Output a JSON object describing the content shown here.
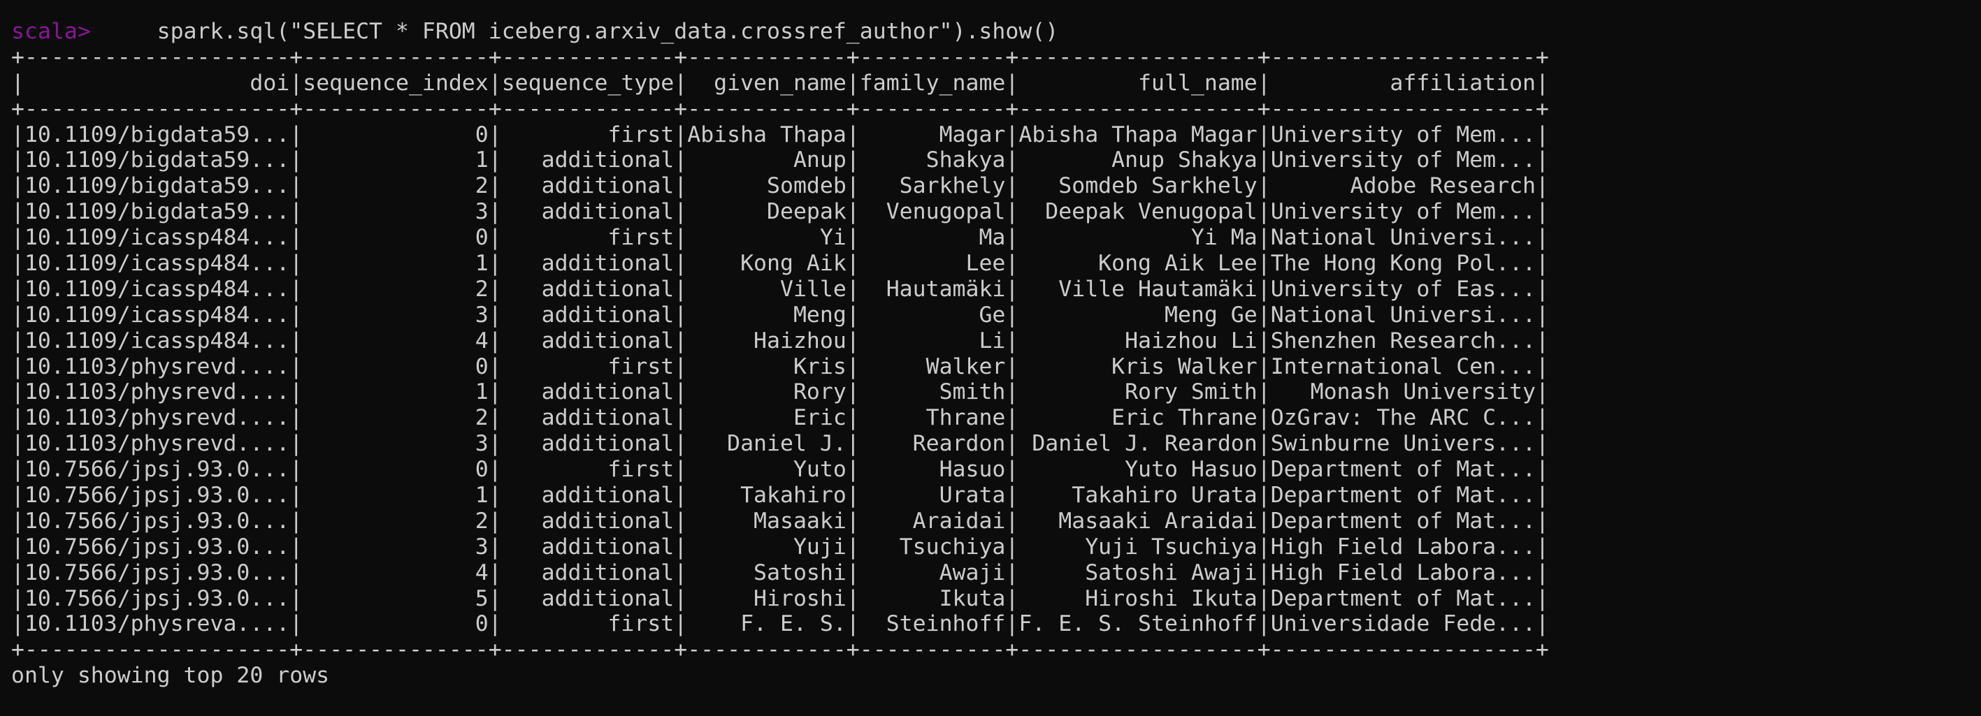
{
  "terminal": {
    "prompt": "scala>",
    "command": "spark.sql(\"SELECT * FROM iceberg.arxiv_data.crossref_author\").show()",
    "footer": "only showing top 20 rows",
    "colors": {
      "background": "#0c0c0c",
      "text": "#cccccc",
      "prompt": "#881798"
    }
  },
  "table": {
    "columns": [
      "doi",
      "sequence_index",
      "sequence_type",
      "given_name",
      "family_name",
      "full_name",
      "affiliation"
    ],
    "rows": [
      [
        "10.1109/bigdata59...",
        "0",
        "first",
        "Abisha Thapa",
        "Magar",
        "Abisha Thapa Magar",
        "University of Mem..."
      ],
      [
        "10.1109/bigdata59...",
        "1",
        "additional",
        "Anup",
        "Shakya",
        "Anup Shakya",
        "University of Mem..."
      ],
      [
        "10.1109/bigdata59...",
        "2",
        "additional",
        "Somdeb",
        "Sarkhely",
        "Somdeb Sarkhely",
        "Adobe Research"
      ],
      [
        "10.1109/bigdata59...",
        "3",
        "additional",
        "Deepak",
        "Venugopal",
        "Deepak Venugopal",
        "University of Mem..."
      ],
      [
        "10.1109/icassp484...",
        "0",
        "first",
        "Yi",
        "Ma",
        "Yi Ma",
        "National Universi..."
      ],
      [
        "10.1109/icassp484...",
        "1",
        "additional",
        "Kong Aik",
        "Lee",
        "Kong Aik Lee",
        "The Hong Kong Pol..."
      ],
      [
        "10.1109/icassp484...",
        "2",
        "additional",
        "Ville",
        "Hautamäki",
        "Ville Hautamäki",
        "University of Eas..."
      ],
      [
        "10.1109/icassp484...",
        "3",
        "additional",
        "Meng",
        "Ge",
        "Meng Ge",
        "National Universi..."
      ],
      [
        "10.1109/icassp484...",
        "4",
        "additional",
        "Haizhou",
        "Li",
        "Haizhou Li",
        "Shenzhen Research..."
      ],
      [
        "10.1103/physrevd....",
        "0",
        "first",
        "Kris",
        "Walker",
        "Kris Walker",
        "International Cen..."
      ],
      [
        "10.1103/physrevd....",
        "1",
        "additional",
        "Rory",
        "Smith",
        "Rory Smith",
        "Monash University"
      ],
      [
        "10.1103/physrevd....",
        "2",
        "additional",
        "Eric",
        "Thrane",
        "Eric Thrane",
        "OzGrav: The ARC C..."
      ],
      [
        "10.1103/physrevd....",
        "3",
        "additional",
        "Daniel J.",
        "Reardon",
        "Daniel J. Reardon",
        "Swinburne Univers..."
      ],
      [
        "10.7566/jpsj.93.0...",
        "0",
        "first",
        "Yuto",
        "Hasuo",
        "Yuto Hasuo",
        "Department of Mat..."
      ],
      [
        "10.7566/jpsj.93.0...",
        "1",
        "additional",
        "Takahiro",
        "Urata",
        "Takahiro Urata",
        "Department of Mat..."
      ],
      [
        "10.7566/jpsj.93.0...",
        "2",
        "additional",
        "Masaaki",
        "Araidai",
        "Masaaki Araidai",
        "Department of Mat..."
      ],
      [
        "10.7566/jpsj.93.0...",
        "3",
        "additional",
        "Yuji",
        "Tsuchiya",
        "Yuji Tsuchiya",
        "High Field Labora..."
      ],
      [
        "10.7566/jpsj.93.0...",
        "4",
        "additional",
        "Satoshi",
        "Awaji",
        "Satoshi Awaji",
        "High Field Labora..."
      ],
      [
        "10.7566/jpsj.93.0...",
        "5",
        "additional",
        "Hiroshi",
        "Ikuta",
        "Hiroshi Ikuta",
        "Department of Mat..."
      ],
      [
        "10.1103/physreva....",
        "0",
        "first",
        "F. E. S.",
        "Steinhoff",
        "F. E. S. Steinhoff",
        "Universidade Fede..."
      ]
    ]
  }
}
